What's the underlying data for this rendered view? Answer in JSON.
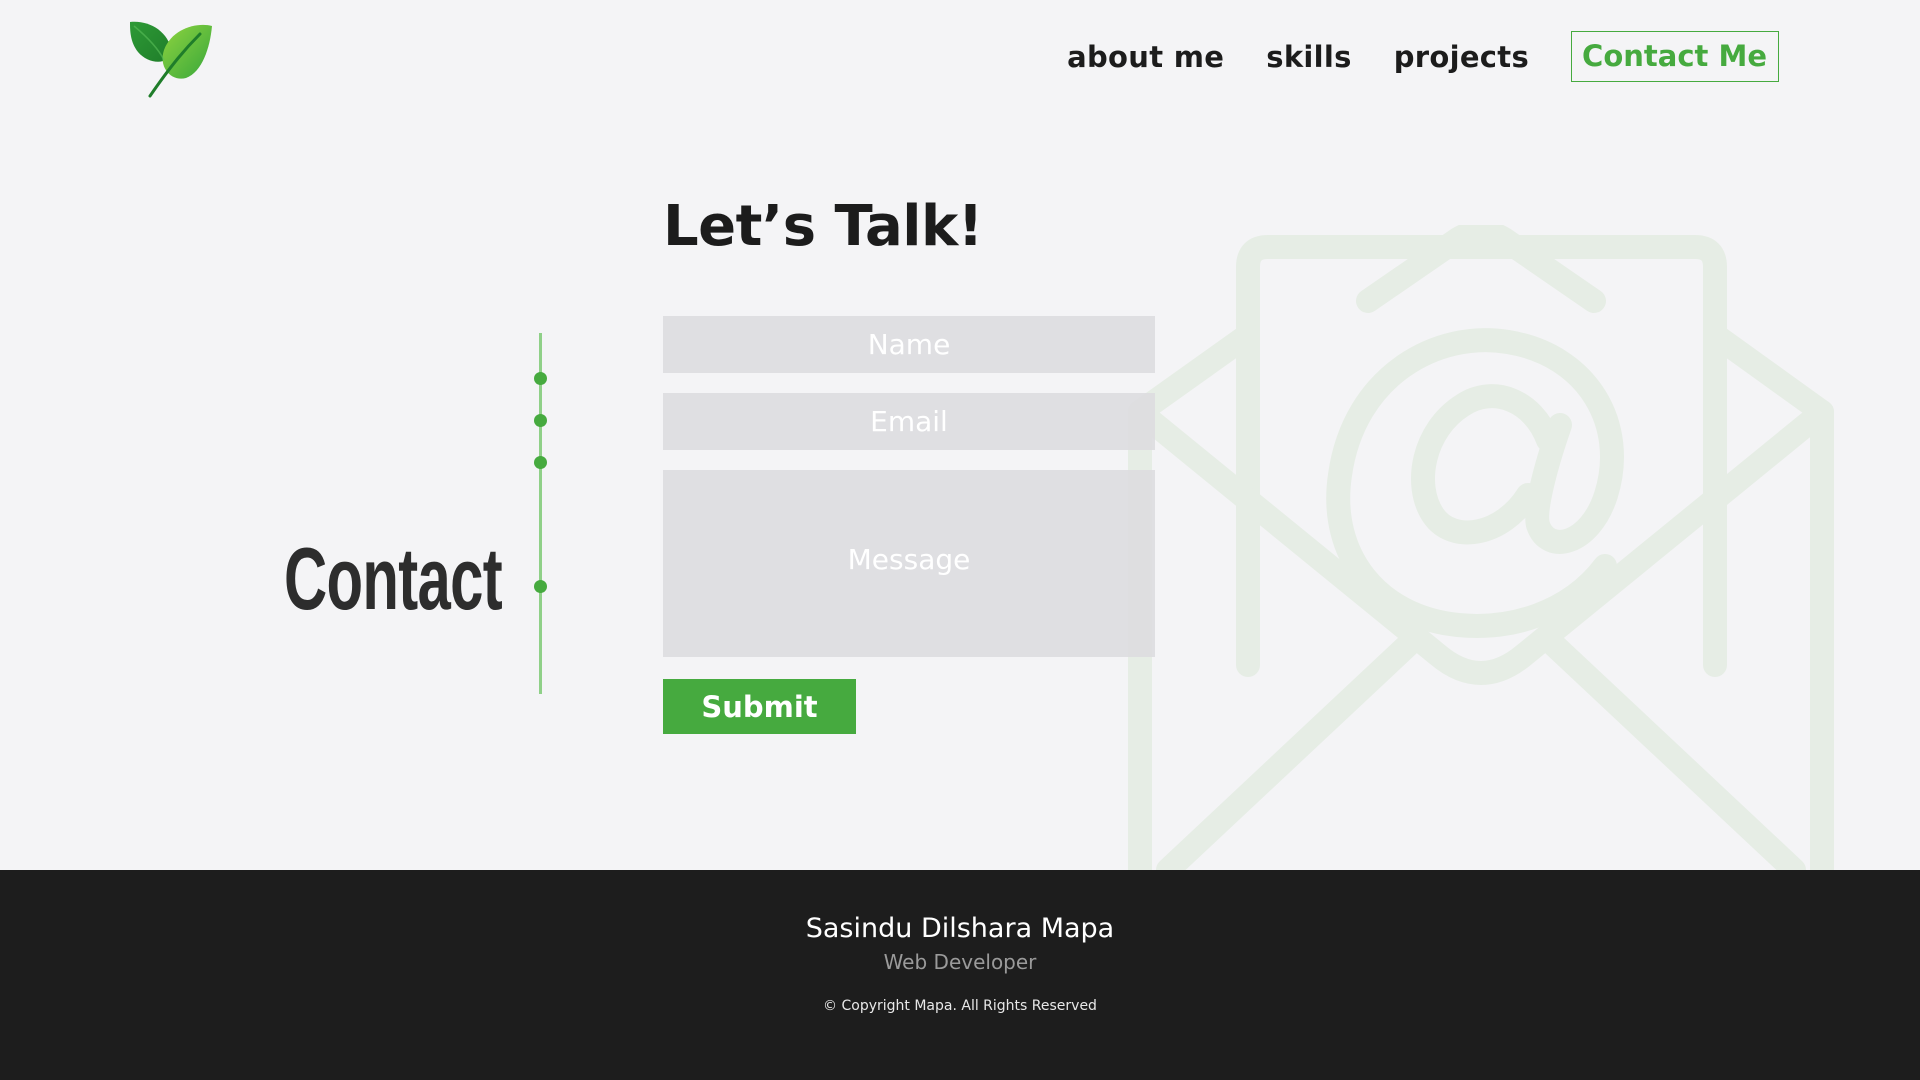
{
  "header": {
    "logo_icon": "leaf-icon",
    "nav": {
      "about": "about me",
      "skills": "skills",
      "projects": "projects",
      "contact": "Contact Me"
    }
  },
  "contact": {
    "section_title": "Contact",
    "heading": "Let’s Talk!",
    "name_placeholder": "Name",
    "email_placeholder": "Email",
    "message_placeholder": "Message",
    "submit_label": "Submit",
    "background_icon": "envelope-at-icon"
  },
  "footer": {
    "name": "Sasindu Dilshara Mapa",
    "role": "Web Developer",
    "copyright": "© Copyright Mapa. All Rights Reserved"
  },
  "colors": {
    "accent": "#46aa3f",
    "background": "#f4f4f6",
    "footer_bg": "#1d1d1d",
    "text_dark": "#1c1c1c"
  }
}
